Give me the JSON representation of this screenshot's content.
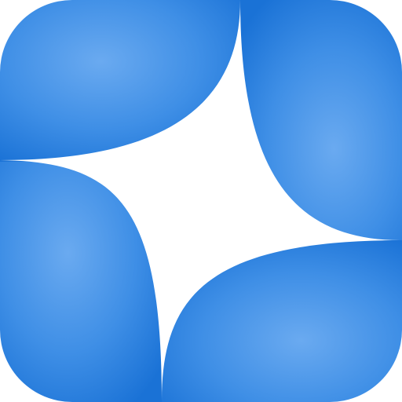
{
  "icon": {
    "name": "sparkle-app-icon",
    "shape": "rounded-square",
    "glyph": "four-point-star",
    "colors": {
      "tile_light": "#6aaaf0",
      "tile_mid": "#3f8fe6",
      "tile_dark": "#1a72d6",
      "glyph": "#ffffff"
    }
  }
}
